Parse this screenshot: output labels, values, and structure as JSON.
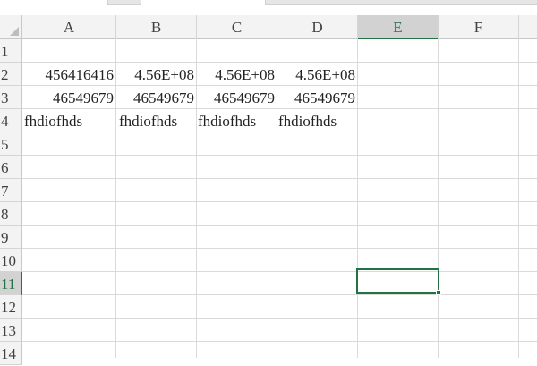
{
  "columns": [
    "A",
    "B",
    "C",
    "D",
    "E",
    "F"
  ],
  "rows": [
    "1",
    "2",
    "3",
    "4",
    "5",
    "6",
    "7",
    "8",
    "9",
    "10",
    "11",
    "12",
    "13",
    "14"
  ],
  "selected_column": "E",
  "selected_row": "11",
  "cells": {
    "A2": "456416416",
    "B2": "4.56E+08",
    "C2": "4.56E+08",
    "D2": "4.56E+08",
    "A3": "46549679",
    "B3": "46549679",
    "C3": "46549679",
    "D3": "46549679",
    "A4": "fhdiofhds",
    "B4": "fhdiofhds",
    "C4": "fhdiofhds",
    "D4": "fhdiofhds"
  },
  "colors": {
    "accent": "#217346",
    "header_bg": "#f3f3f3",
    "selected_header_bg": "#d2d2d2",
    "gridline": "#dadada"
  }
}
